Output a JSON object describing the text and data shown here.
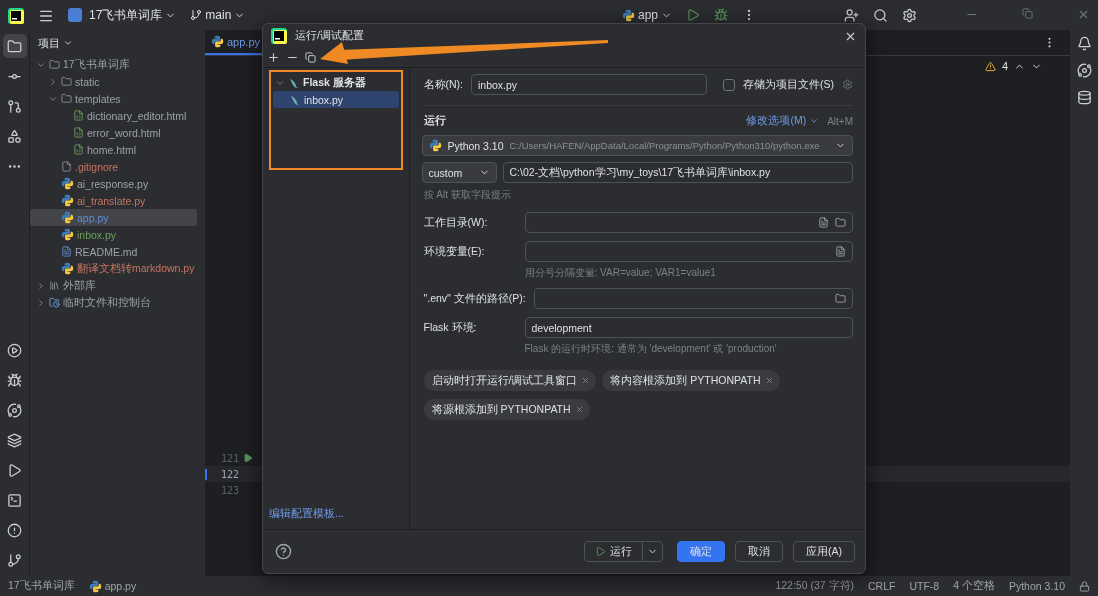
{
  "title_bar": {
    "project": "17飞书单词库",
    "branch": "main",
    "run_config": "app"
  },
  "left_toolbar": {
    "top": [
      {
        "selected": true
      },
      {
        "selected": false
      },
      {
        "selected": false
      },
      {
        "selected": false
      },
      {
        "selected": false
      }
    ],
    "bottom": [
      {
        "selected": false
      },
      {
        "selected": false
      },
      {
        "selected": false
      },
      {
        "selected": false
      },
      {
        "selected": false
      },
      {
        "selected": false
      },
      {
        "selected": false
      },
      {
        "selected": false
      }
    ]
  },
  "project_panel": {
    "title": "项目",
    "tree": [
      {
        "label": "17飞书单词库",
        "kind": "folder",
        "selected": false,
        "expanded": true,
        "children": [
          {
            "label": "static",
            "kind": "folder",
            "selected": false,
            "expanded": false
          },
          {
            "label": "templates",
            "kind": "folder",
            "selected": false,
            "expanded": true,
            "children": [
              {
                "label": "dictionary_editor.html",
                "kind": "html",
                "selected": false
              },
              {
                "label": "error_word.html",
                "kind": "html",
                "selected": false
              },
              {
                "label": "home.html",
                "kind": "html",
                "selected": false
              }
            ]
          },
          {
            "label": ".gitignore",
            "kind": "file",
            "color": "#c7735f",
            "selected": false
          },
          {
            "label": "ai_response.py",
            "kind": "py",
            "selected": false
          },
          {
            "label": "ai_translate.py",
            "kind": "py",
            "color": "#c7735f",
            "selected": false
          },
          {
            "label": "app.py",
            "kind": "py",
            "color": "#5f8dd3",
            "selected": true
          },
          {
            "label": "inbox.py",
            "kind": "py",
            "color": "#6a9f5b",
            "selected": false
          },
          {
            "label": "README.md",
            "kind": "md",
            "selected": false
          },
          {
            "label": "翻译文档转markdown.py",
            "kind": "py",
            "color": "#c7735f",
            "selected": false
          }
        ]
      },
      {
        "label": "外部库",
        "kind": "lib",
        "selected": false,
        "expanded": false
      },
      {
        "label": "临时文件和控制台",
        "kind": "scratch",
        "selected": false,
        "expanded": false
      }
    ]
  },
  "editor": {
    "tabs": [
      {
        "label": "app.py",
        "selected": true
      }
    ],
    "problems_count": "4",
    "line_numbers": [
      {
        "number": "121",
        "runnable": true,
        "current": false
      },
      {
        "number": "122",
        "runnable": false,
        "current": true
      },
      {
        "number": "123",
        "runnable": false,
        "current": false
      }
    ]
  },
  "dialog": {
    "title": "运行/调试配置",
    "config_tree": [
      {
        "label": "Flask 服务器",
        "selected": false,
        "expanded": true,
        "children": [
          {
            "label": "inbox.py",
            "selected": true
          }
        ]
      }
    ],
    "edit_templates_link": "编辑配置模板...",
    "name_label": "名称(N):",
    "name_value": "inbox.py",
    "store_as_project_file": {
      "label": "存储为项目文件(S)",
      "checked": false
    },
    "section_title": "运行",
    "modify_options": "修改选项(M)",
    "modify_shortcut": "Alt+M",
    "interpreter": {
      "name": "Python 3.10",
      "path": "C:/Users/HAFEN/AppData/Local/Programs/Python/Python310/python.exe"
    },
    "target_type": "custom",
    "target_path": "C:\\02-文档\\python学习\\my_toys\\17飞书单词库\\inbox.py",
    "alt_hint": "按 Alt 获取字段提示",
    "fields": [
      {
        "label": "工作目录(W):",
        "editor_button": true,
        "browse_button": true
      },
      {
        "label": "环境变量(E):",
        "editor_button": true,
        "hint": "用分号分隔变量: VAR=value; VAR1=value1"
      },
      {
        "label": "\".env\" 文件的路径(P):",
        "browse_button": true
      },
      {
        "label": "Flask 环境:",
        "value": "development",
        "hint": "Flask 的运行时环境: 通常为 'development' 或 'production'"
      }
    ],
    "chips": [
      "启动时打开运行/调试工具窗口",
      "将内容根添加到 PYTHONPATH",
      "将源根添加到 PYTHONPATH"
    ],
    "buttons": {
      "run": "运行",
      "ok": "确定",
      "cancel": "取消",
      "apply": "应用(A)"
    }
  },
  "status_bar": {
    "breadcrumbs": [
      "17飞书单词库",
      "app.py"
    ],
    "items": [
      "122:50 (37 字符)",
      "CRLF",
      "UTF-8",
      "4 个空格",
      "Python 3.10"
    ]
  }
}
